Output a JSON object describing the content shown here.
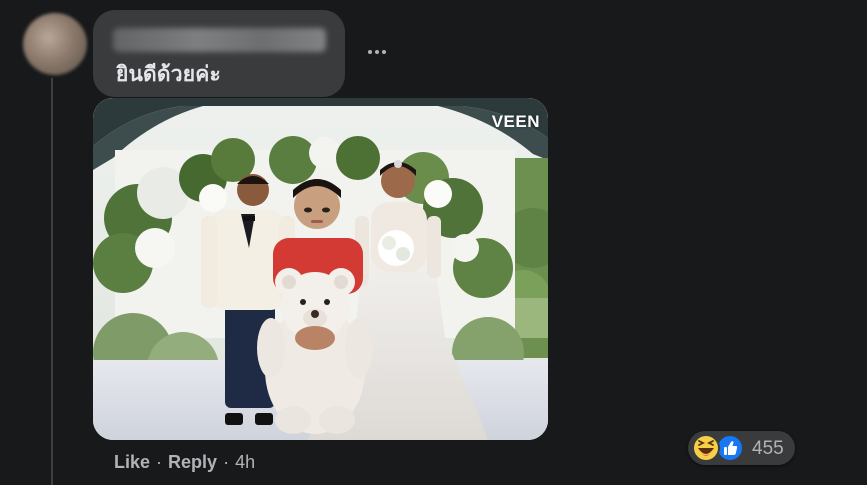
{
  "comment": {
    "text": "ยินดีด้วยค่ะ",
    "more_icon": "more-horizontal-icon"
  },
  "photo": {
    "watermark": "VEEN"
  },
  "actions": {
    "like_label": "Like",
    "separator": "·",
    "reply_label": "Reply",
    "time": "4h"
  },
  "reactions": {
    "count": "455",
    "icons": [
      "haha-icon",
      "like-icon"
    ]
  },
  "colors": {
    "background": "#18191a",
    "bubble": "#3a3b3c",
    "text_primary": "#e4e6eb",
    "text_secondary": "#b0b3b8",
    "like_blue": "#1877f2",
    "haha_yellow": "#f7d046"
  }
}
